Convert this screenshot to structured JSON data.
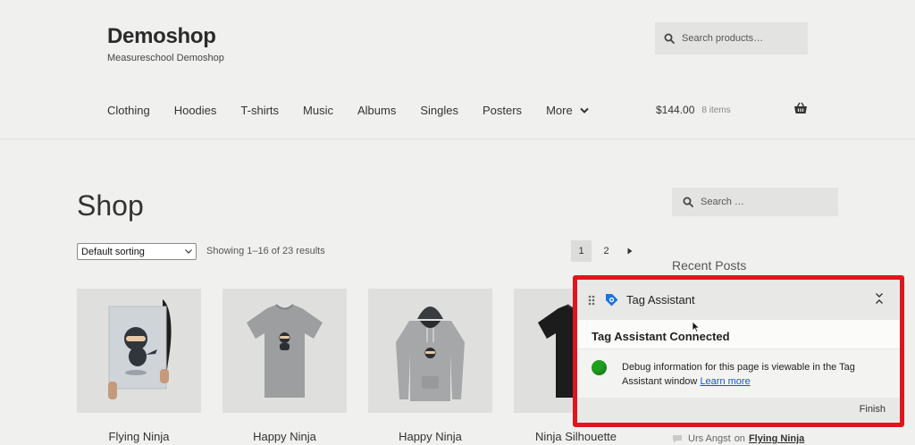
{
  "site": {
    "title": "Demoshop",
    "tagline": "Measureschool Demoshop"
  },
  "header_search": {
    "placeholder": "Search products…"
  },
  "nav": {
    "items": [
      "Clothing",
      "Hoodies",
      "T-shirts",
      "Music",
      "Albums",
      "Singles",
      "Posters"
    ],
    "more": "More"
  },
  "cart": {
    "amount": "$144.00",
    "count": "8 items"
  },
  "shop": {
    "title": "Shop",
    "sort": "Default sorting",
    "results": "Showing 1–16 of 23 results",
    "pages": [
      "1",
      "2"
    ]
  },
  "products": [
    {
      "name": "Flying Ninja"
    },
    {
      "name": "Happy Ninja"
    },
    {
      "name": "Happy Ninja"
    },
    {
      "name": "Ninja Silhouette"
    }
  ],
  "sidebar": {
    "search_placeholder": "Search …",
    "recent_posts": "Recent Posts",
    "comment_author": "Urs Angst",
    "comment_on": "on",
    "comment_link": "Flying Ninja"
  },
  "tag_assistant": {
    "title": "Tag Assistant",
    "status": "Tag Assistant Connected",
    "message": "Debug information for this page is viewable in the Tag Assistant window",
    "learn_more": "Learn more",
    "finish": "Finish"
  },
  "colors": {
    "background": "#f0f1ef",
    "highlight_border": "#e0161c",
    "status_green": "#1fa11f",
    "link_blue": "#1a55c7"
  }
}
